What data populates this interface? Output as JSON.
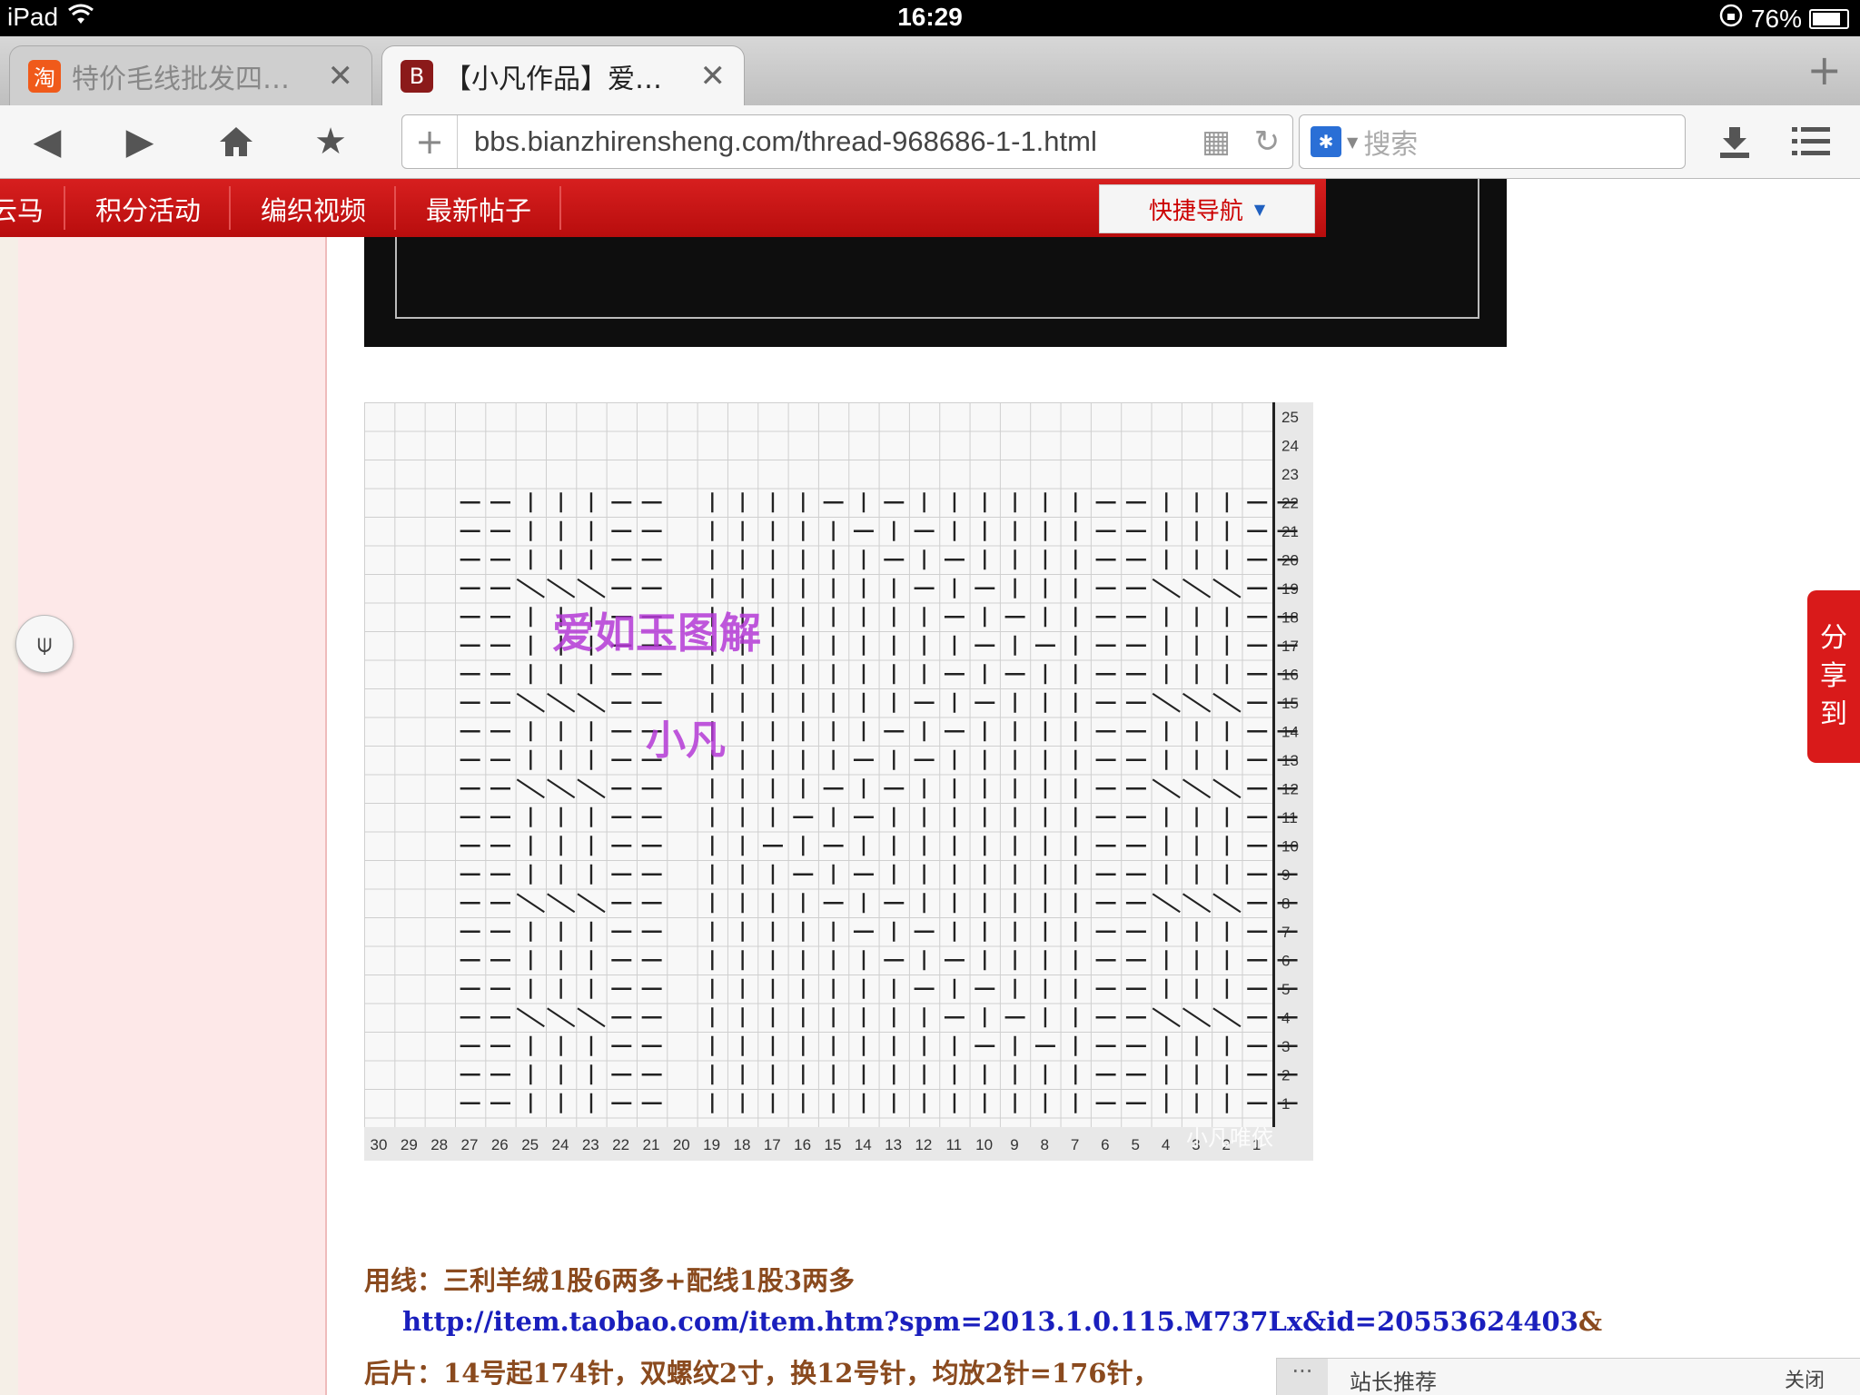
{
  "status_bar": {
    "device": "iPad",
    "time": "16:29",
    "battery": "76%"
  },
  "tabs": [
    {
      "label": "特价毛线批发四…",
      "icon": "淘",
      "icon_color": "#f05a1a",
      "active": false
    },
    {
      "label": "【小凡作品】爱…",
      "icon": "B",
      "icon_color": "#8b1a1a",
      "active": true
    }
  ],
  "toolbar": {
    "url": "bbs.bianzhirensheng.com/thread-968686-1-1.html",
    "search_placeholder": "搜索"
  },
  "site_nav": {
    "items": [
      "云马",
      "积分活动",
      "编织视频",
      "最新帖子"
    ],
    "quick_nav_label": "快捷导航"
  },
  "chart_data": {
    "type": "table",
    "overlay_title": "爱如玉图解",
    "overlay_author": "小凡",
    "watermark": "小凡唯依",
    "row_numbers": [
      "25",
      "24",
      "23",
      "22",
      "21",
      "20",
      "19",
      "18",
      "17",
      "16",
      "15",
      "14",
      "13",
      "12",
      "11",
      "10",
      "9",
      "8",
      "7",
      "6",
      "5",
      "4",
      "3",
      "2",
      "1"
    ],
    "column_numbers": [
      "30",
      "29",
      "28",
      "27",
      "26",
      "25",
      "24",
      "23",
      "22",
      "21",
      "20",
      "19",
      "18",
      "17",
      "16",
      "15",
      "14",
      "13",
      "12",
      "11",
      "10",
      "9",
      "8",
      "7",
      "6",
      "5",
      "4",
      "3",
      "2",
      "1"
    ]
  },
  "content": {
    "yarn_label": "用线：",
    "yarn_text": "三利羊绒1股6两多+配线1股3两多",
    "link": "http://item.taobao.com/item.htm?spm=2013.1.0.115.M737Lx&id=20553624403",
    "link_tail": "&",
    "back_label": "后片：",
    "back_text": "14号起174针，双螺纹2寸，换12号针，均放2针=176针，"
  },
  "share_label": [
    "分",
    "享",
    "到"
  ],
  "bottom_panel": {
    "title": "站长推荐",
    "close": "关闭"
  },
  "colors": {
    "nav_red": "#c81414",
    "content_brown": "#8a4a1e",
    "link_blue": "#1a1fbd",
    "overlay_purple": "#b53ad6"
  }
}
